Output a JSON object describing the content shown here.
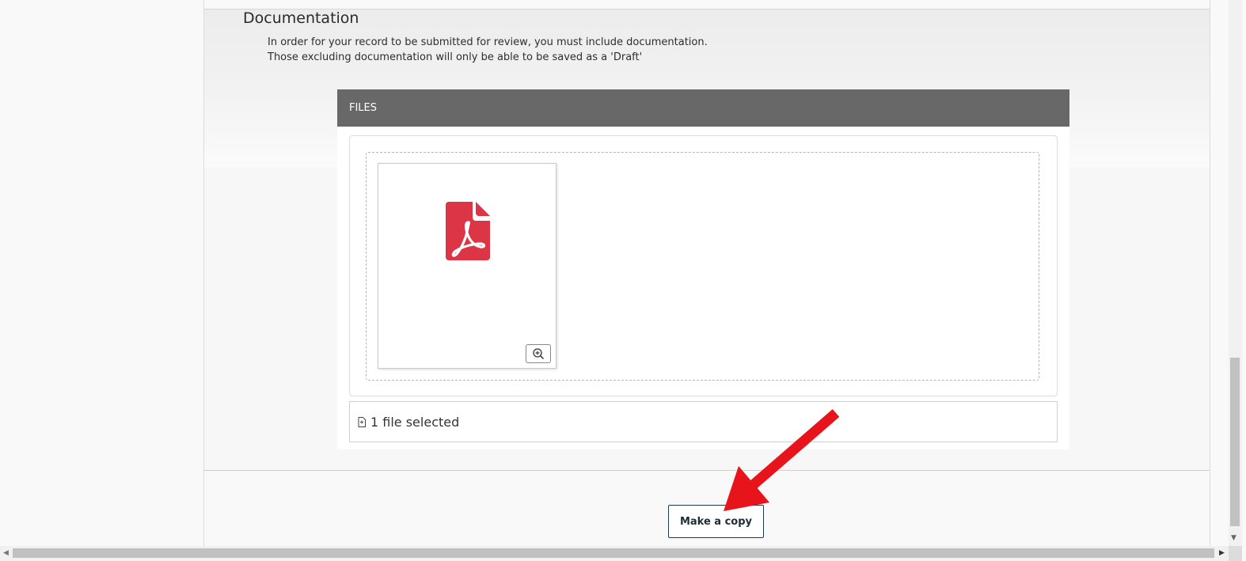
{
  "documentation": {
    "title": "Documentation",
    "description_line1": "In order for your record to be submitted for review, you must include documentation.",
    "description_line2": "Those excluding documentation will only be able to be saved as a 'Draft'"
  },
  "files": {
    "header": "FILES",
    "items": [
      {
        "type": "pdf",
        "icon": "pdf-file-icon",
        "icon_color": "#dc3545"
      }
    ],
    "status_text": "1 file selected",
    "zoom_icon": "zoom-in-icon"
  },
  "actions": {
    "make_copy_label": "Make a copy"
  },
  "annotation": {
    "arrow_color": "#e8141b"
  },
  "scrollbars": {
    "up_glyph": "▲",
    "down_glyph": "▼",
    "left_glyph": "◀",
    "right_glyph": "▶"
  }
}
